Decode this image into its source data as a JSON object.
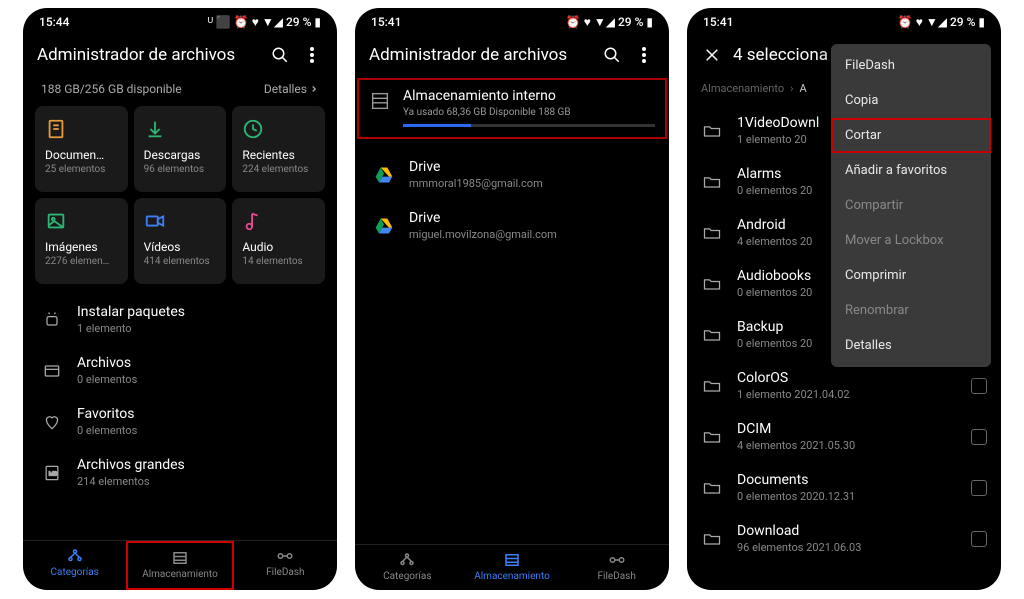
{
  "screen1": {
    "time": "15:44",
    "statusIcons": "ᵁ ⬛   ⏰ ♥ ▼◢ 29 % ▮",
    "title": "Administrador de archivos",
    "storageLine": "188 GB/256 GB disponible",
    "detailsLabel": "Detalles",
    "cards": [
      {
        "label": "Documen…",
        "sub": "25 elementos",
        "color": "#e59a3a"
      },
      {
        "label": "Descargas",
        "sub": "96 elementos",
        "color": "#2bb673"
      },
      {
        "label": "Recientes",
        "sub": "224 elementos",
        "color": "#2bb673"
      },
      {
        "label": "Imágenes",
        "sub": "2276 elemen…",
        "color": "#2bb673"
      },
      {
        "label": "Vídeos",
        "sub": "414 elementos",
        "color": "#3d7ff5"
      },
      {
        "label": "Audio",
        "sub": "14 elementos",
        "color": "#e84a8f"
      }
    ],
    "list": [
      {
        "title": "Instalar paquetes",
        "sub": "1 elemento"
      },
      {
        "title": "Archivos",
        "sub": "0 elementos"
      },
      {
        "title": "Favoritos",
        "sub": "0 elementos"
      },
      {
        "title": "Archivos grandes",
        "sub": "214 elementos"
      }
    ],
    "tabs": [
      {
        "label": "Categorías"
      },
      {
        "label": "Almacenamiento"
      },
      {
        "label": "FileDash"
      }
    ]
  },
  "screen2": {
    "time": "15:41",
    "statusIcons": "⏰ ♥ ▼◢ 29 % ▮",
    "title": "Administrador de archivos",
    "storage": {
      "title": "Almacenamiento interno",
      "sub": "Ya usado 68,36 GB   Disponible 188 GB"
    },
    "drives": [
      {
        "title": "Drive",
        "sub": "mmmoral1985@gmail.com"
      },
      {
        "title": "Drive",
        "sub": "miguel.movilzona@gmail.com"
      }
    ],
    "tabs": [
      {
        "label": "Categorías"
      },
      {
        "label": "Almacenamiento"
      },
      {
        "label": "FileDash"
      }
    ]
  },
  "screen3": {
    "time": "15:41",
    "statusIcons": "⏰ ♥ ▼◢ 29 % ▮",
    "selectedTitle": "4 selecciona",
    "breadcrumb": [
      "Almacenamiento",
      "A"
    ],
    "folders": [
      {
        "title": "1VideoDownl",
        "sub": "1 elemento   20"
      },
      {
        "title": "Alarms",
        "sub": "0 elementos   20"
      },
      {
        "title": "Android",
        "sub": "4 elementos   20"
      },
      {
        "title": "Audiobooks",
        "sub": "0 elementos   20"
      },
      {
        "title": "Backup",
        "sub": "0 elementos   20"
      },
      {
        "title": "ColorOS",
        "sub": "1 elemento   2021.04.02"
      },
      {
        "title": "DCIM",
        "sub": "4 elementos   2021.05.30"
      },
      {
        "title": "Documents",
        "sub": "0 elementos   2020.12.31"
      },
      {
        "title": "Download",
        "sub": "96 elementos   2021.06.03"
      }
    ],
    "menu": [
      {
        "label": "FileDash",
        "disabled": false
      },
      {
        "label": "Copia",
        "disabled": false
      },
      {
        "label": "Cortar",
        "disabled": false,
        "highlight": true
      },
      {
        "label": "Añadir a favoritos",
        "disabled": false
      },
      {
        "label": "Compartir",
        "disabled": true
      },
      {
        "label": "Mover a Lockbox",
        "disabled": true
      },
      {
        "label": "Comprimir",
        "disabled": false
      },
      {
        "label": "Renombrar",
        "disabled": true
      },
      {
        "label": "Detalles",
        "disabled": false
      }
    ]
  }
}
